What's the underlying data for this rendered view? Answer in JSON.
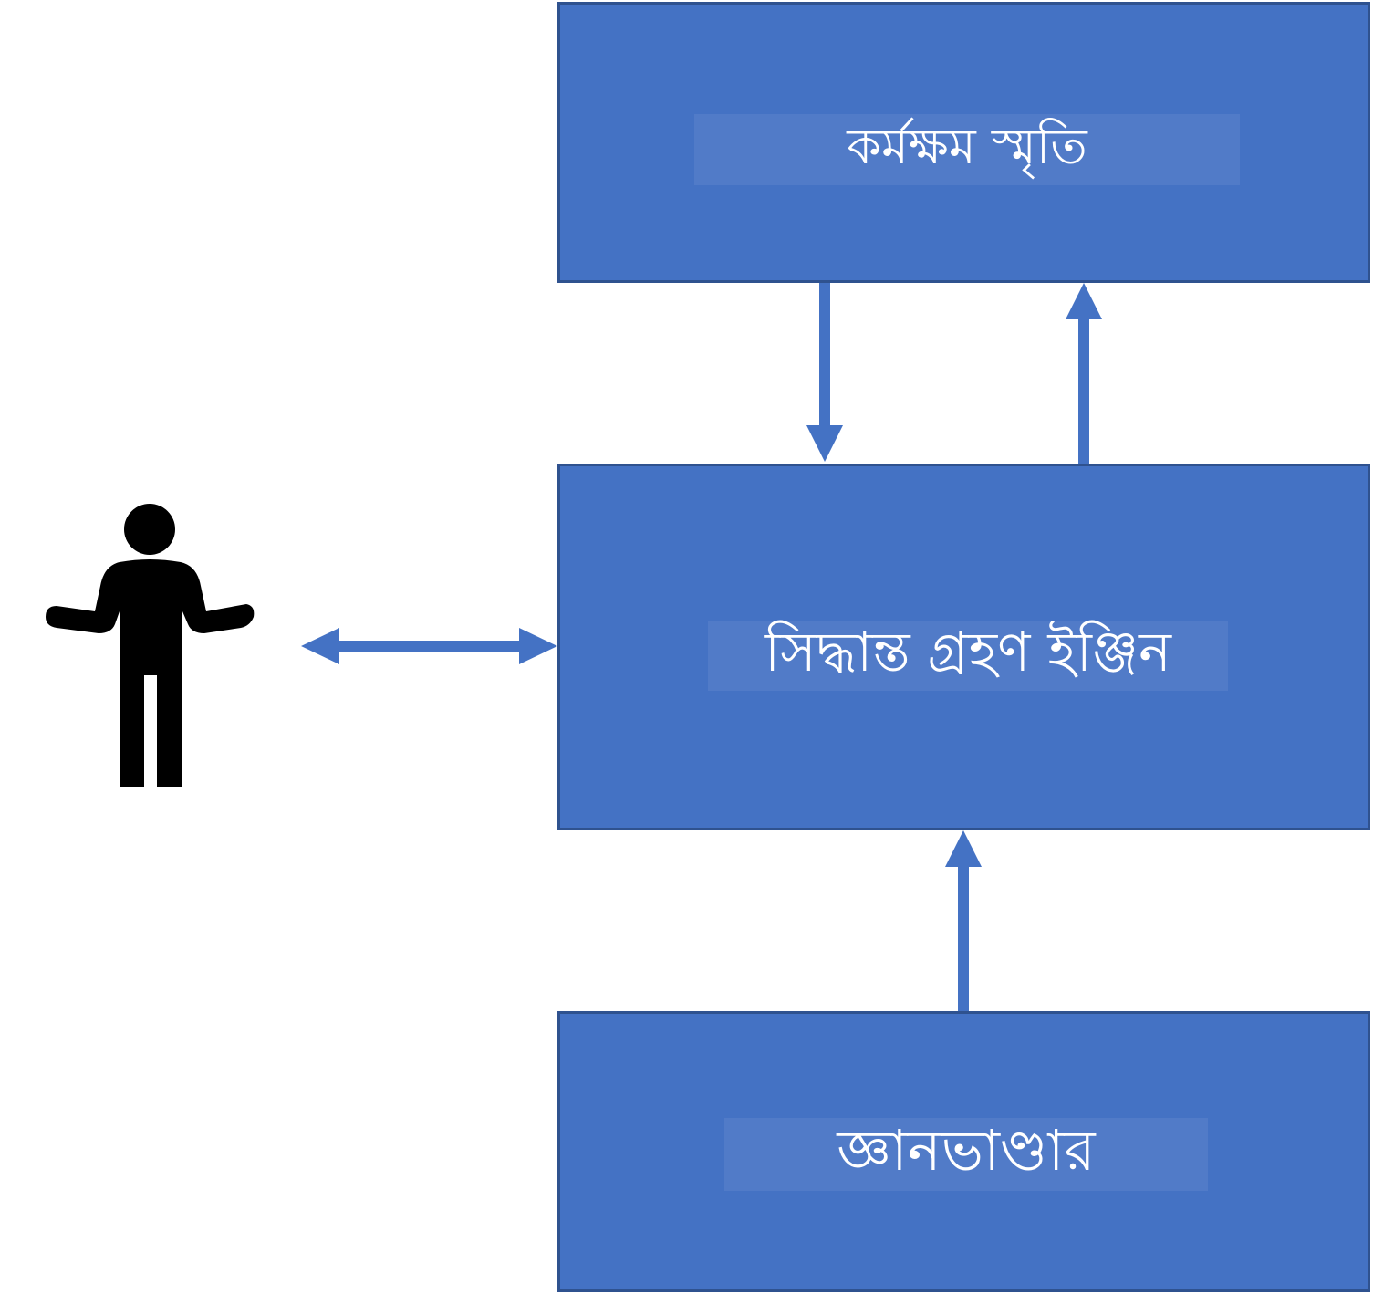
{
  "diagram": {
    "nodes": {
      "working_memory": {
        "label": "কর্মক্ষম স্মৃতি"
      },
      "decision_engine": {
        "label": "সিদ্ধান্ত গ্রহণ ইঞ্জিন"
      },
      "knowledge_base": {
        "label": "জ্ঞানভাণ্ডার"
      }
    },
    "actor": {
      "icon": "person-icon"
    },
    "edges": [
      {
        "from": "working_memory",
        "to": "decision_engine",
        "direction": "one-way"
      },
      {
        "from": "decision_engine",
        "to": "working_memory",
        "direction": "one-way"
      },
      {
        "from": "knowledge_base",
        "to": "decision_engine",
        "direction": "one-way"
      },
      {
        "from": "actor",
        "to": "decision_engine",
        "direction": "two-way"
      }
    ],
    "colors": {
      "box_fill": "#4472C4",
      "box_border": "#2F528F",
      "arrow": "#4472C4",
      "actor": "#000000",
      "label_text": "#ffffff"
    }
  }
}
